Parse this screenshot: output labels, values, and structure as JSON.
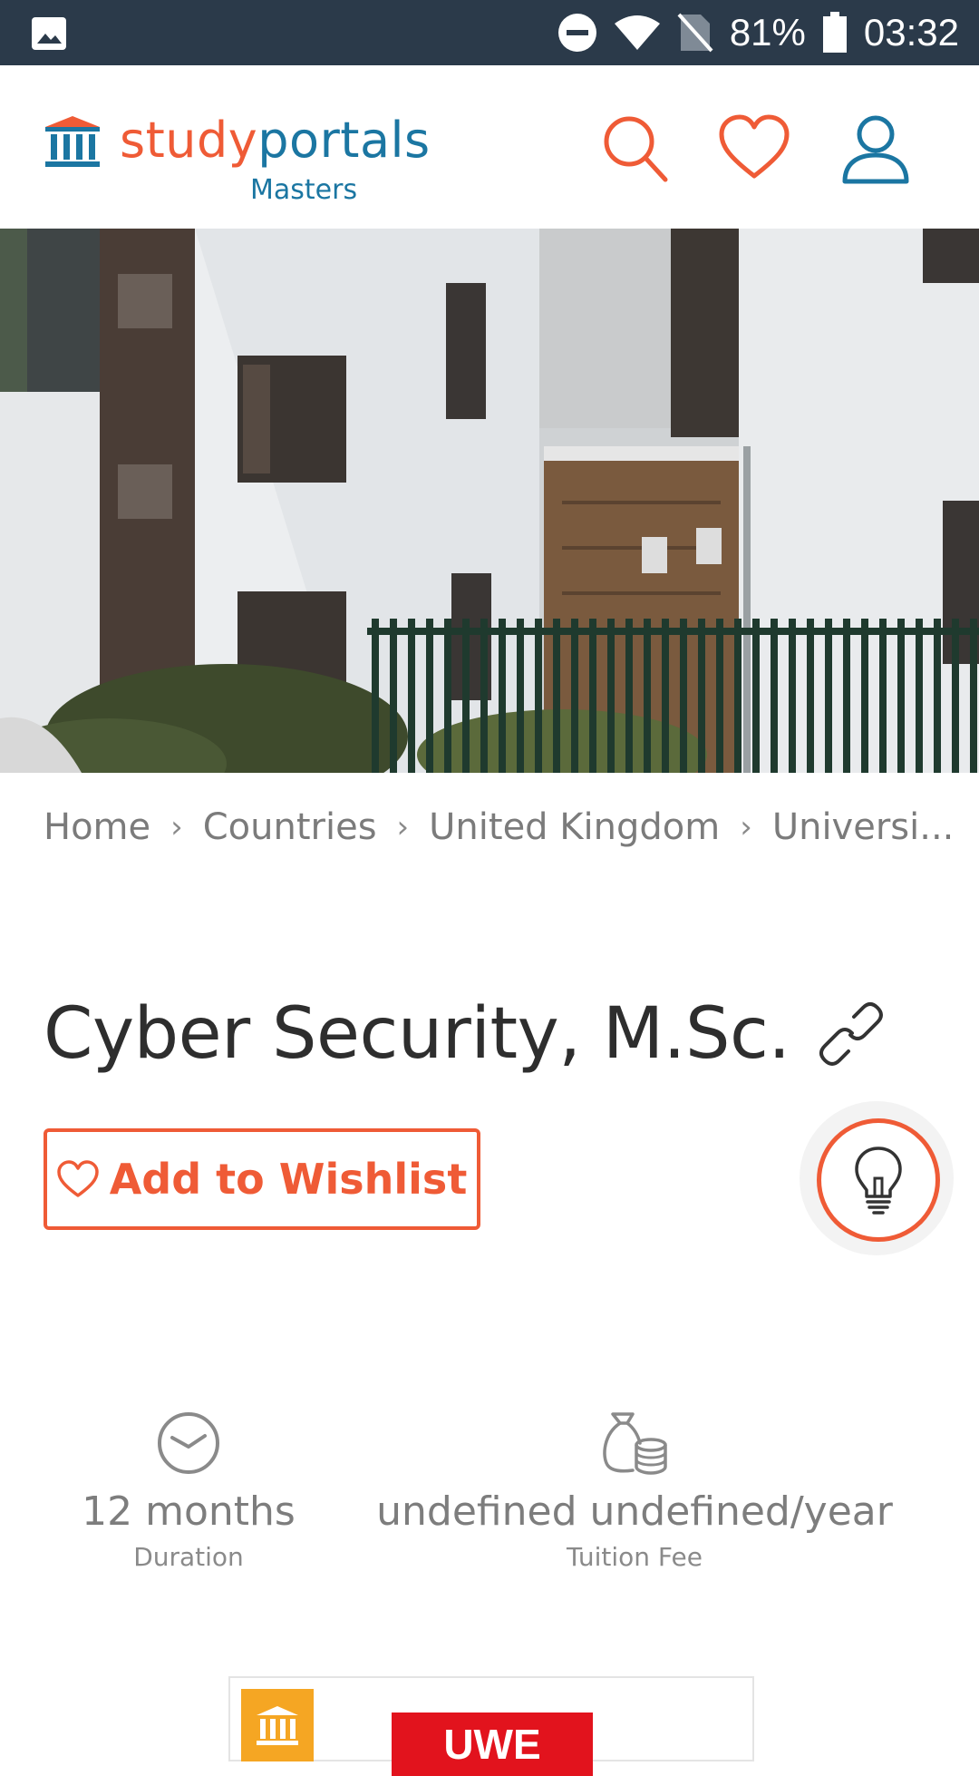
{
  "status_bar": {
    "battery": "81%",
    "time": "03:32"
  },
  "header": {
    "logo_part1": "study",
    "logo_part2": "portals",
    "logo_sub": "Masters"
  },
  "breadcrumb": [
    "Home",
    "Countries",
    "United Kingdom",
    "Universi..."
  ],
  "title": "Cyber Security, M.Sc.",
  "wishlist_label": "Add to Wishlist",
  "facts": {
    "duration_value": "12 months",
    "duration_label": "Duration",
    "fee_value": "undefined undefined/year",
    "fee_label": "Tuition Fee"
  },
  "university_card": {
    "logo_text": "UWE"
  },
  "colors": {
    "accent": "#ef5b36",
    "brand_blue": "#1b76a2",
    "status_bar": "#2b3a4a"
  }
}
